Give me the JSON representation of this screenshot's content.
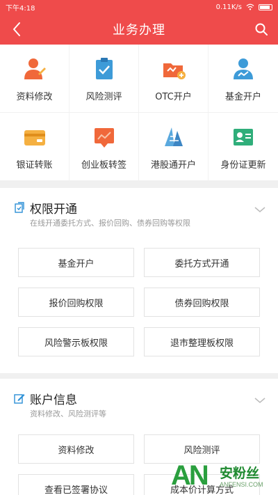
{
  "status_bar": {
    "time": "下午4:18",
    "speed": "0.11K/s"
  },
  "header": {
    "title": "业务办理"
  },
  "services": [
    {
      "label": "资料修改",
      "icon": "user-edit-icon"
    },
    {
      "label": "风险测评",
      "icon": "clipboard-check-icon"
    },
    {
      "label": "OTC开户",
      "icon": "otc-folder-icon"
    },
    {
      "label": "基金开户",
      "icon": "fund-user-icon"
    },
    {
      "label": "银证转账",
      "icon": "card-transfer-icon"
    },
    {
      "label": "创业板转签",
      "icon": "chart-board-icon"
    },
    {
      "label": "港股通开户",
      "icon": "hk-stock-icon"
    },
    {
      "label": "身份证更新",
      "icon": "id-card-icon"
    }
  ],
  "permissions": {
    "title": "权限开通",
    "subtitle": "在线开通委托方式、报价回购、债券回购等权限",
    "options": [
      "基金开户",
      "委托方式开通",
      "报价回购权限",
      "债券回购权限",
      "风险警示板权限",
      "退市整理板权限"
    ]
  },
  "account": {
    "title": "账户信息",
    "subtitle": "资料修改、风险测评等",
    "options": [
      "资料修改",
      "风险测评",
      "查看已签署协议",
      "成本价计算方式"
    ]
  },
  "watermark": {
    "letters": "AN",
    "cn": "安粉丝",
    "en": "ANFENSI.COM"
  },
  "colors": {
    "brand": "#ef4b4b",
    "accent": "#2b8fd6",
    "watermark": "#2a9f3e"
  }
}
